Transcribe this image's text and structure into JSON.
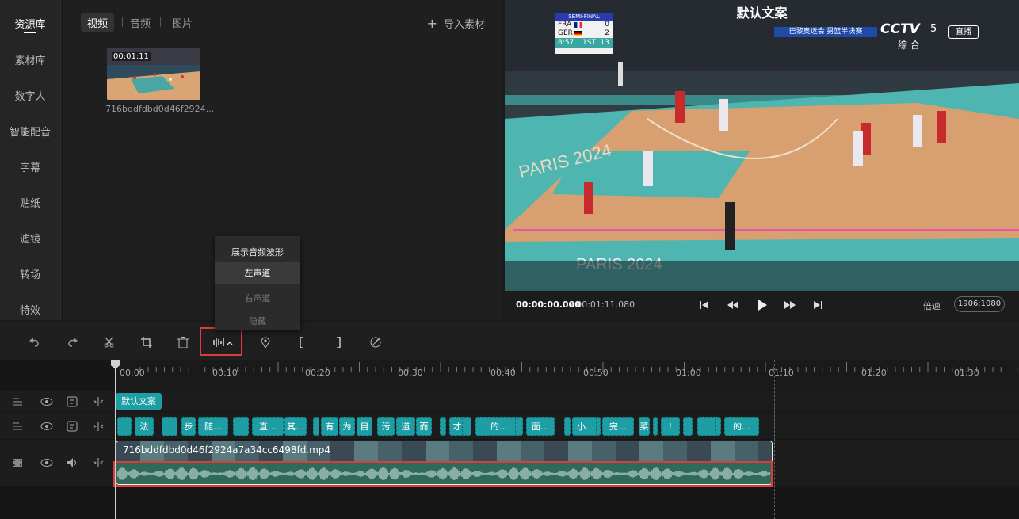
{
  "sidebar": {
    "items": [
      {
        "label": "资源库",
        "active": true
      },
      {
        "label": "素材库"
      },
      {
        "label": "数字人"
      },
      {
        "label": "智能配音"
      },
      {
        "label": "字幕"
      },
      {
        "label": "贴纸"
      },
      {
        "label": "滤镜"
      },
      {
        "label": "转场"
      },
      {
        "label": "特效"
      }
    ]
  },
  "media": {
    "tabs": [
      {
        "label": "视频",
        "active": true
      },
      {
        "label": "音频"
      },
      {
        "label": "图片"
      }
    ],
    "import_label": "导入素材",
    "clip": {
      "duration": "00:01:11",
      "name": "716bddfdbd0d46f2924..."
    }
  },
  "dropdown": {
    "items": [
      {
        "label": "展示音频波形",
        "state": "normal"
      },
      {
        "label": "左声道",
        "state": "selected"
      },
      {
        "label": "右声道",
        "state": "disabled"
      },
      {
        "label": "隐藏",
        "state": "disabled"
      }
    ]
  },
  "preview": {
    "overlay_text": "默认文案",
    "broadcast": {
      "stage": "SEMI-FINAL",
      "team1": "FRA",
      "score1": "0",
      "team2": "GER",
      "score2": "2",
      "clock": "8:57",
      "period": "1ST",
      "shot": "13",
      "banner": "巴黎奥运会 男篮半决赛",
      "channel": "CCTV",
      "channel_num": "5",
      "channel_sub": "综 合",
      "live": "直播",
      "court_text": "PARIS 2024"
    },
    "current_time": "00:00:00.000",
    "total_time": "/ 00:01:11.080",
    "speed_label": "倍速",
    "resolution": "1906:1080"
  },
  "timeline": {
    "ruler": [
      "00:00",
      "00:10",
      "00:20",
      "00:30",
      "00:40",
      "00:50",
      "01:00",
      "01:10",
      "01:20",
      "01:30"
    ],
    "text_clip": "默认文案",
    "subtitle_chips": [
      "法",
      "步",
      "随…",
      "直…",
      "其…",
      "有",
      "为",
      "目",
      "污",
      "道",
      "而",
      "才",
      "的…",
      "面…",
      "小…",
      "完…",
      "菜",
      "!",
      "的…"
    ],
    "video_clip_name": "716bddfdbd0d46f2924a7a34cc6498fd.mp4"
  },
  "colors": {
    "accent": "#1d9da4",
    "highlight": "#e03b3b",
    "playhead": "#d0d0d0"
  }
}
